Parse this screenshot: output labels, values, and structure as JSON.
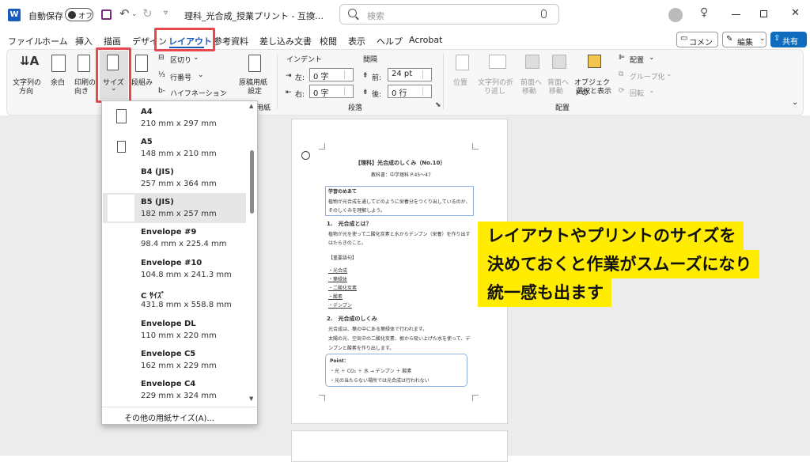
{
  "titlebar": {
    "app_icon": "word-icon",
    "autosave_label": "自動保存",
    "autosave_toggle": "オフ",
    "save_icon": "save-icon",
    "filename": "理科_光合成_授業プリント - 互換…",
    "search_placeholder": "検索"
  },
  "menubar": {
    "items": [
      "ファイル",
      "ホーム",
      "挿入",
      "描画",
      "デザイン",
      "レイアウト",
      "参考資料",
      "差し込み文書",
      "校閲",
      "表示",
      "ヘルプ",
      "Acrobat"
    ],
    "comment_btn": "コメント",
    "edit_btn": "編集",
    "share_btn": "共有"
  },
  "ribbon": {
    "text_direction": [
      "文字列の",
      "方向"
    ],
    "margins": "余白",
    "orientation": [
      "印刷の",
      "向き"
    ],
    "size": "サイズ",
    "columns": "段組み",
    "breaks": "区切り",
    "line_numbers": "行番号",
    "hyphenation": "ハイフネーション",
    "manuscript": [
      "原稿用紙",
      "設定"
    ],
    "manuscript_group": "用紙",
    "indent_label": "インデント",
    "spacing_label": "間隔",
    "indent_left_label": "左:",
    "indent_left_value": "0 字",
    "indent_right_label": "右:",
    "indent_right_value": "0 字",
    "spacing_before_label": "前:",
    "spacing_before_value": "24 pt",
    "spacing_after_label": "後:",
    "spacing_after_value": "0 行",
    "paragraph_group": "段落",
    "position": "位置",
    "wrap_text": [
      "文字列の折",
      "り返し"
    ],
    "bring_forward": [
      "前面へ",
      "移動"
    ],
    "send_backward": [
      "背面へ",
      "移動"
    ],
    "selection_pane": [
      "オブジェクトの",
      "選択と表示"
    ],
    "align": "配置",
    "group": "グループ化",
    "rotate": "回転",
    "arrange_group": "配置"
  },
  "size_dropdown": {
    "items": [
      {
        "name": "A4",
        "dims": "210 mm x 297 mm"
      },
      {
        "name": "A5",
        "dims": "148 mm x 210 mm"
      },
      {
        "name": "B4 (JIS)",
        "dims": "257 mm x 364 mm"
      },
      {
        "name": "B5 (JIS)",
        "dims": "182 mm x 257 mm"
      },
      {
        "name": "Envelope #9",
        "dims": "98.4 mm x 225.4 mm"
      },
      {
        "name": "Envelope #10",
        "dims": "104.8 mm x 241.3 mm"
      },
      {
        "name": "C ｻｲｽﾞ",
        "dims": "431.8 mm x 558.8 mm"
      },
      {
        "name": "Envelope DL",
        "dims": "110 mm x 220 mm"
      },
      {
        "name": "Envelope C5",
        "dims": "162 mm x 229 mm"
      },
      {
        "name": "Envelope C4",
        "dims": "229 mm x 324 mm"
      }
    ],
    "selected": "B5 (JIS)",
    "more": "その他の用紙サイズ(A)..."
  },
  "document": {
    "title": "【理科】光合成のしくみ（No.10）",
    "textbook": "教科書：中学理科 P.45〜47",
    "goal_heading": "学習のめあて",
    "goal_line1": "植物が光合成を通してどのように栄養分をつくり出しているのか、",
    "goal_line2": "そのしくみを理解しよう。",
    "section1": "1.　光合成とは？",
    "s1_line1": "植物が光を使って二酸化炭素と水からデンプン（栄養）を作り出す",
    "s1_line2": "はたらきのこと。",
    "terms_heading": "【重要語句】",
    "terms": [
      "・光合成",
      "・葉緑体",
      "・二酸化炭素",
      "・酸素",
      "・デンプン"
    ],
    "section2": "2.　光合成のしくみ",
    "s2_line1": "光合成は、葉の中にある葉緑体で行われます。",
    "s2_line2": "太陽の光、空気中の二酸化炭素、根から吸い上げた水を使って、デ",
    "s2_line3": "ンプンと酸素を作り出します。",
    "point_heading": "Point：",
    "point_line1": "・光 ＋ CO₂ ＋ 水 → デンプン ＋ 酸素",
    "point_line2": "・光の当たらない場所では光合成は行われない"
  },
  "callout": {
    "lines": [
      "レイアウトやプリントのサイズを",
      "決めておくと作業がスムーズになり",
      "統一感も出ます"
    ]
  },
  "colors": {
    "highlight_red": "#e8474d",
    "callout_yellow": "#ffec00",
    "share_blue": "#0f6cbd",
    "word_blue": "#185abd"
  }
}
